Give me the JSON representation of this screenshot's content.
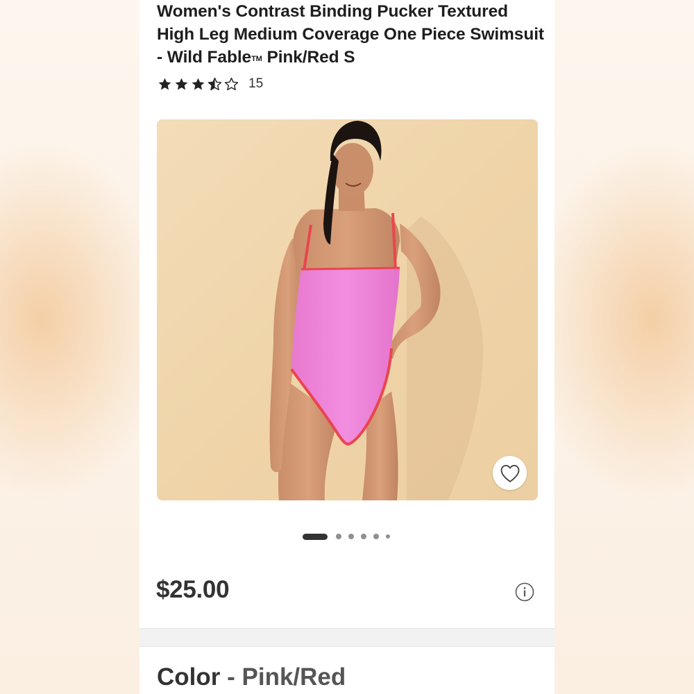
{
  "product": {
    "title_main": "Women's Contrast Binding Pucker Textured High Leg Medium Coverage One Piece Swimsuit - Wild Fable",
    "trademark": "TM",
    "title_variant": "Pink/Red S",
    "rating": {
      "stars_filled": 3.5,
      "stars_total": 5,
      "review_count": "15"
    },
    "price": "$25.00",
    "color_label": "Color",
    "color_separator": "-",
    "color_value": "Pink/Red"
  },
  "carousel": {
    "total_dots": 6,
    "active_index": 0
  },
  "icons": {
    "star": "star-icon",
    "favorite": "heart-outline-icon",
    "info": "info-circle-icon"
  },
  "colors": {
    "text_primary": "#333333",
    "swimsuit_pink": "#f07fd6",
    "binding_red": "#e8464f",
    "backdrop": "#f1d7b0"
  }
}
